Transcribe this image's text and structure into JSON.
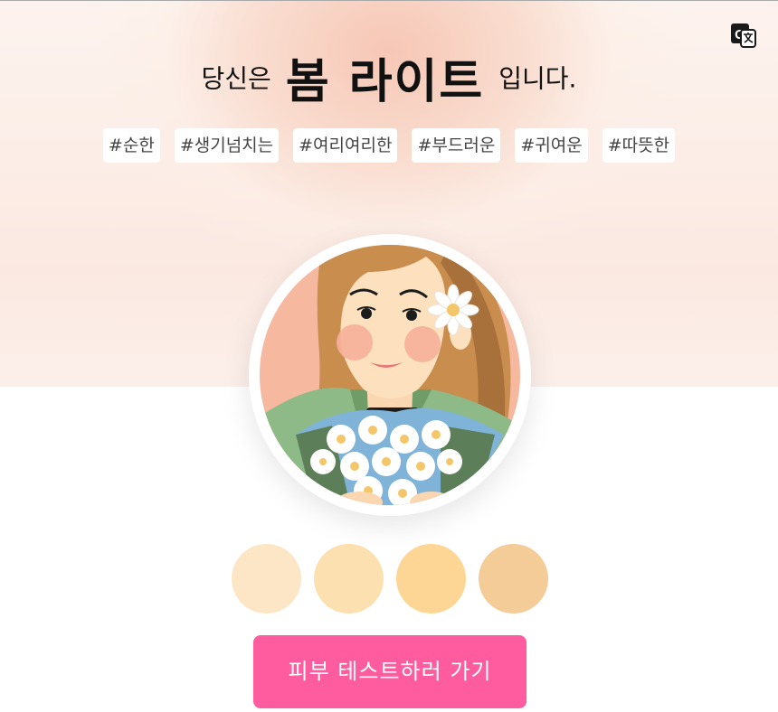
{
  "header": {
    "translate_icon": "google-translate-icon"
  },
  "result": {
    "prefix": "당신은",
    "type_name": "봄 라이트",
    "suffix": "입니다."
  },
  "tags": [
    "#순한",
    "#생기넘치는",
    "#여리여리한",
    "#부드러운",
    "#귀여운",
    "#따뜻한"
  ],
  "avatar": {
    "description_icon": "girl-with-daisies-illustration"
  },
  "swatches": [
    {
      "color": "#fde6c6"
    },
    {
      "color": "#fde0b0"
    },
    {
      "color": "#fdd696"
    },
    {
      "color": "#f4cc98"
    }
  ],
  "cta": {
    "label": "피부 테스트하러 가기",
    "color": "#ff5c9f"
  }
}
